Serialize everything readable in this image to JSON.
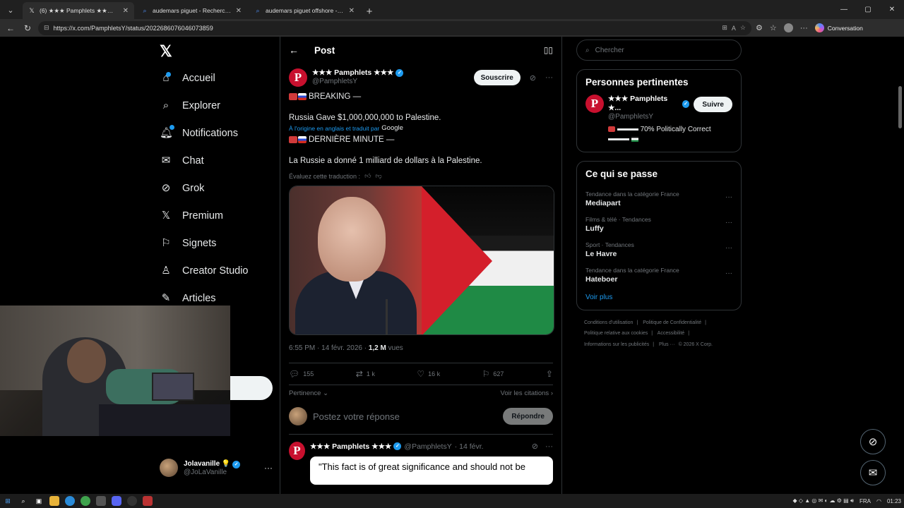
{
  "browser": {
    "tabs": [
      {
        "title": "(6) ★★★ Pamphlets ★★★ sur X :",
        "icon": "x-icon",
        "active": true
      },
      {
        "title": "audemars piguet - Recherche",
        "icon": "search-icon",
        "active": false
      },
      {
        "title": "audemars piguet offshore - Reche",
        "icon": "search-icon",
        "active": false
      }
    ],
    "url": "https://x.com/PamphletsY/status/2022686076046073859",
    "conversation_label": "Conversation"
  },
  "nav": {
    "items": [
      {
        "label": "Accueil",
        "icon": "home-icon"
      },
      {
        "label": "Explorer",
        "icon": "search-icon"
      },
      {
        "label": "Notifications",
        "icon": "bell-icon"
      },
      {
        "label": "Chat",
        "icon": "mail-icon"
      },
      {
        "label": "Grok",
        "icon": "grok-icon"
      },
      {
        "label": "Premium",
        "icon": "x-icon"
      },
      {
        "label": "Signets",
        "icon": "bookmark-icon"
      },
      {
        "label": "Creator Studio",
        "icon": "creator-icon"
      },
      {
        "label": "Articles",
        "icon": "article-icon"
      }
    ],
    "profile": {
      "name": "Jolavanille",
      "handle": "@JoLaVanille",
      "emoji": "💡"
    }
  },
  "post": {
    "header": "Post",
    "author": {
      "name": "★★★ Pamphlets ★★★",
      "handle": "@PamphletsY",
      "avatar_letter": "P"
    },
    "subscribe_label": "Souscrire",
    "line1": "BREAKING —",
    "line2": "Russia Gave $1,000,000,000 to Palestine.",
    "translated_label": "À l'origine en anglais et traduit par",
    "translator": "Google",
    "line3": "DERNIÈRE MINUTE —",
    "line4": "La Russie a donné 1 milliard de dollars à la Palestine.",
    "rate_label": "Évaluez cette traduction :",
    "time": "6:55 PM · 14 févr. 2026 · ",
    "views": "1,2 M",
    "views_label": " vues",
    "stats": {
      "replies": "155",
      "reposts": "1 k",
      "likes": "16 k",
      "bookmarks": "627"
    },
    "sort_label": "Pertinence",
    "quotes_label": "Voir les citations",
    "reply_placeholder": "Postez votre réponse",
    "reply_button": "Répondre"
  },
  "reply_tweet": {
    "name": "★★★ Pamphlets ★★★",
    "handle": "@PamphletsY",
    "date": "· 14 févr.",
    "quote": "\"This fact is of great significance and should not be"
  },
  "right": {
    "search_placeholder": "Chercher",
    "relevant_title": "Personnes pertinentes",
    "relevant": {
      "name": "★★★ Pamphlets ★...",
      "handle": "@PamphletsY",
      "follow_label": "Suivre",
      "bio": "70% Politically Correct"
    },
    "trends_title": "Ce qui se passe",
    "trends": [
      {
        "context": "Tendance dans la catégorie France",
        "name": "Mediapart"
      },
      {
        "context": "Films & télé · Tendances",
        "name": "Luffy"
      },
      {
        "context": "Sport · Tendances",
        "name": "Le Havre"
      },
      {
        "context": "Tendance dans la catégorie France",
        "name": "Hateboer"
      }
    ],
    "see_more": "Voir plus",
    "footer": [
      "Conditions d'utilisation",
      "|",
      "Politique de Confidentialité",
      "|",
      "Politique relative aux cookies",
      "|",
      "Accessibilité",
      "|",
      "Informations sur les publicités",
      "|",
      "Plus ···",
      "© 2026 X Corp."
    ]
  },
  "taskbar": {
    "lang": "FRA",
    "time": "01:23"
  }
}
